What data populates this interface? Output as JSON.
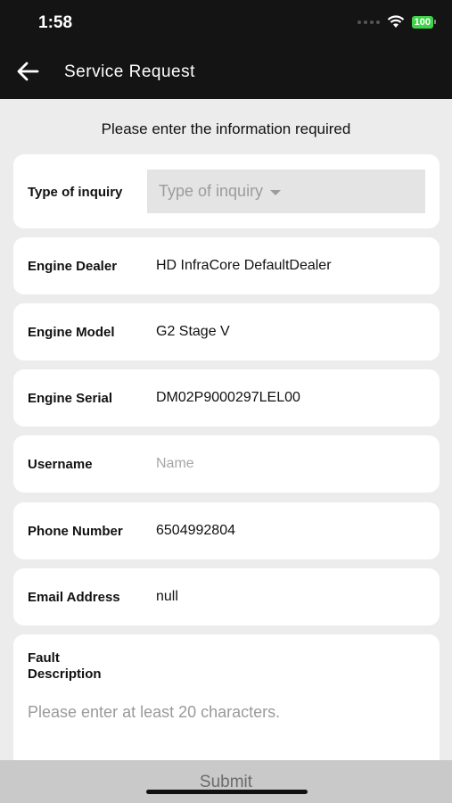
{
  "status": {
    "time": "1:58",
    "battery": "100"
  },
  "header": {
    "title": "Service Request"
  },
  "instruction": "Please enter the information required",
  "fields": {
    "inquiry_label": "Type of inquiry",
    "inquiry_placeholder": "Type of inquiry",
    "dealer_label": "Engine Dealer",
    "dealer_value": "HD InfraCore DefaultDealer",
    "model_label": "Engine Model",
    "model_value": "G2 Stage V",
    "serial_label": "Engine Serial",
    "serial_value": "DM02P9000297LEL00",
    "username_label": "Username",
    "username_placeholder": "Name",
    "phone_label": "Phone Number",
    "phone_value": "6504992804",
    "email_label": "Email Address",
    "email_value": "null",
    "fault_label_line1": "Fault",
    "fault_label_line2": "Description",
    "fault_placeholder": "Please enter at least 20 characters."
  },
  "submit": {
    "label": "Submit"
  },
  "colors": {
    "battery": "#3fd34a",
    "header_bg": "#141414",
    "page_bg": "#ececec"
  },
  "icons": {
    "back": "arrow-left-icon",
    "wifi": "wifi-icon",
    "dropdown": "caret-down-icon"
  }
}
